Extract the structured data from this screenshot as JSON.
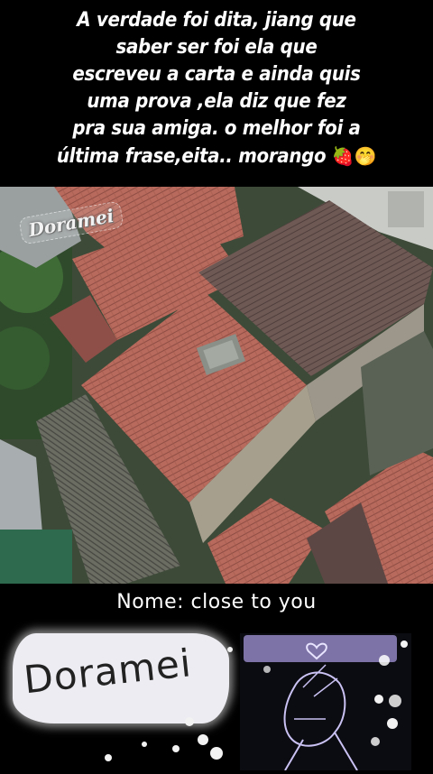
{
  "caption": {
    "lines": [
      "A verdade foi dita, jiang que",
      "saber ser foi ela que",
      "escreveu a carta e ainda quis",
      "uma prova ,ela diz que fez",
      "pra sua amiga. o melhor foi a",
      "última frase,eita.. morango"
    ],
    "emojis": "🍓🤭"
  },
  "watermark": "Doramei",
  "name_label": "Nome: close to you",
  "logo_text": "Doramei",
  "colors": {
    "roof_main": "#b6645a",
    "roof_dark": "#6e5b56",
    "foliage": "#3d5a35",
    "logo_purple": "#8a82b3"
  }
}
